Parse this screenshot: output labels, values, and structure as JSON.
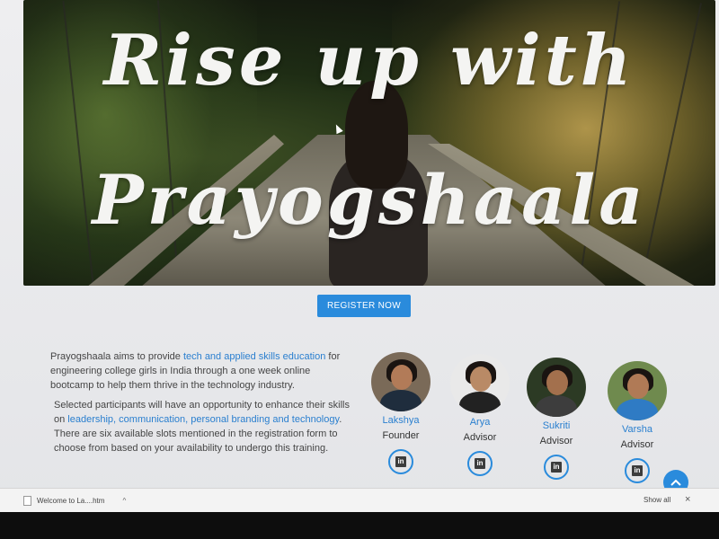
{
  "hero": {
    "title_line1": "Rise up with",
    "title_line2": "Prayogshaala"
  },
  "register_button": "REGISTER NOW",
  "intro": {
    "p1_a": "Prayogshaala aims to provide ",
    "p1_hl": "tech and applied skills education",
    "p1_b": " for engineering college girls in India through a one week online bootcamp to help them thrive in the technology industry.",
    "p2_a": "Selected participants will have an opportunity to enhance their skills on ",
    "p2_hl": "leadership, communication, personal branding and technology",
    "p2_b": ". There are six available slots mentioned in the registration form to choose from based on your availability to undergo this training."
  },
  "team": [
    {
      "name": "Lakshya",
      "role": "Founder",
      "linkedin": "in"
    },
    {
      "name": "Arya",
      "role": "Advisor",
      "linkedin": "in"
    },
    {
      "name": "Sukriti",
      "role": "Advisor",
      "linkedin": "in"
    },
    {
      "name": "Varsha",
      "role": "Advisor",
      "linkedin": "in"
    }
  ],
  "scroll_top_icon": "chevron-up-icon",
  "download_bar": {
    "file_name": "Welcome to La....htm",
    "show_all": "Show all",
    "close": "×"
  },
  "colors": {
    "accent": "#2a8bdc",
    "link": "#2a7fcf"
  }
}
